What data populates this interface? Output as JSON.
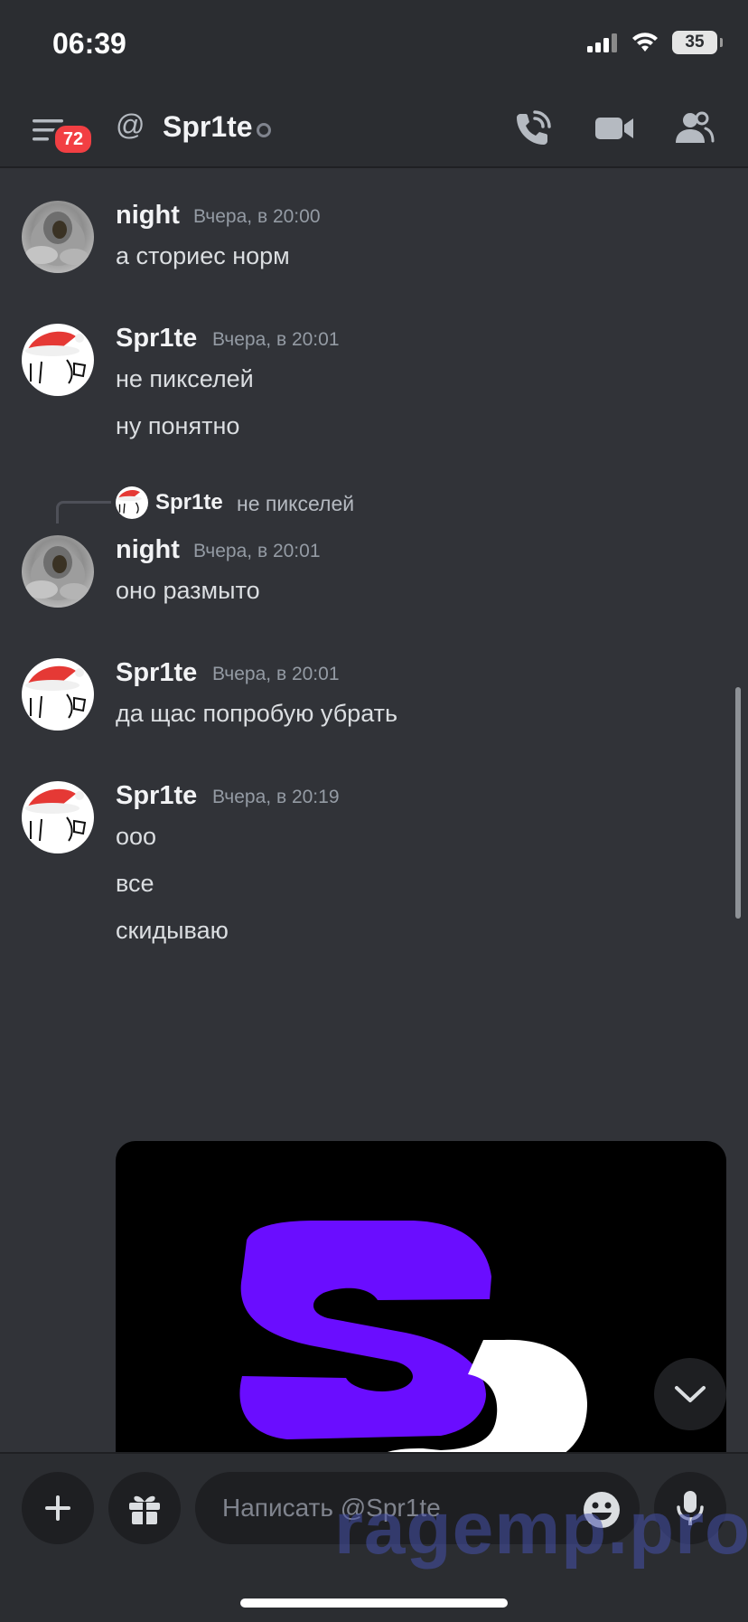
{
  "status_bar": {
    "time": "06:39",
    "battery": "35"
  },
  "header": {
    "notification_count": "72",
    "channel_name": "Spr1te"
  },
  "messages": [
    {
      "author": "night",
      "timestamp": "Вчера, в 20:00",
      "lines": [
        "а сториес норм"
      ]
    },
    {
      "author": "Spr1te",
      "timestamp": "Вчера, в 20:01",
      "lines": [
        "не пикселей",
        "ну понятно"
      ]
    },
    {
      "reply": {
        "author": "Spr1te",
        "text": "не пикселей"
      },
      "author": "night",
      "timestamp": "Вчера, в 20:01",
      "lines": [
        "оно размыто"
      ]
    },
    {
      "author": "Spr1te",
      "timestamp": "Вчера, в 20:01",
      "lines": [
        "да щас попробую убрать"
      ]
    },
    {
      "author": "Spr1te",
      "timestamp": "Вчера, в 20:19",
      "lines": [
        "ооо",
        "все",
        "скидываю"
      ]
    }
  ],
  "composer": {
    "placeholder": "Написать @Spr1te",
    "watermark": "ragemp.pro"
  },
  "colors": {
    "accent_purple": "#6a0dff",
    "badge_red": "#f23f43",
    "background": "#313338"
  },
  "icons": [
    "menu-icon",
    "at-icon",
    "call-icon",
    "video-icon",
    "members-icon",
    "plus-icon",
    "gift-icon",
    "emoji-icon",
    "mic-icon",
    "chevron-down-icon"
  ]
}
